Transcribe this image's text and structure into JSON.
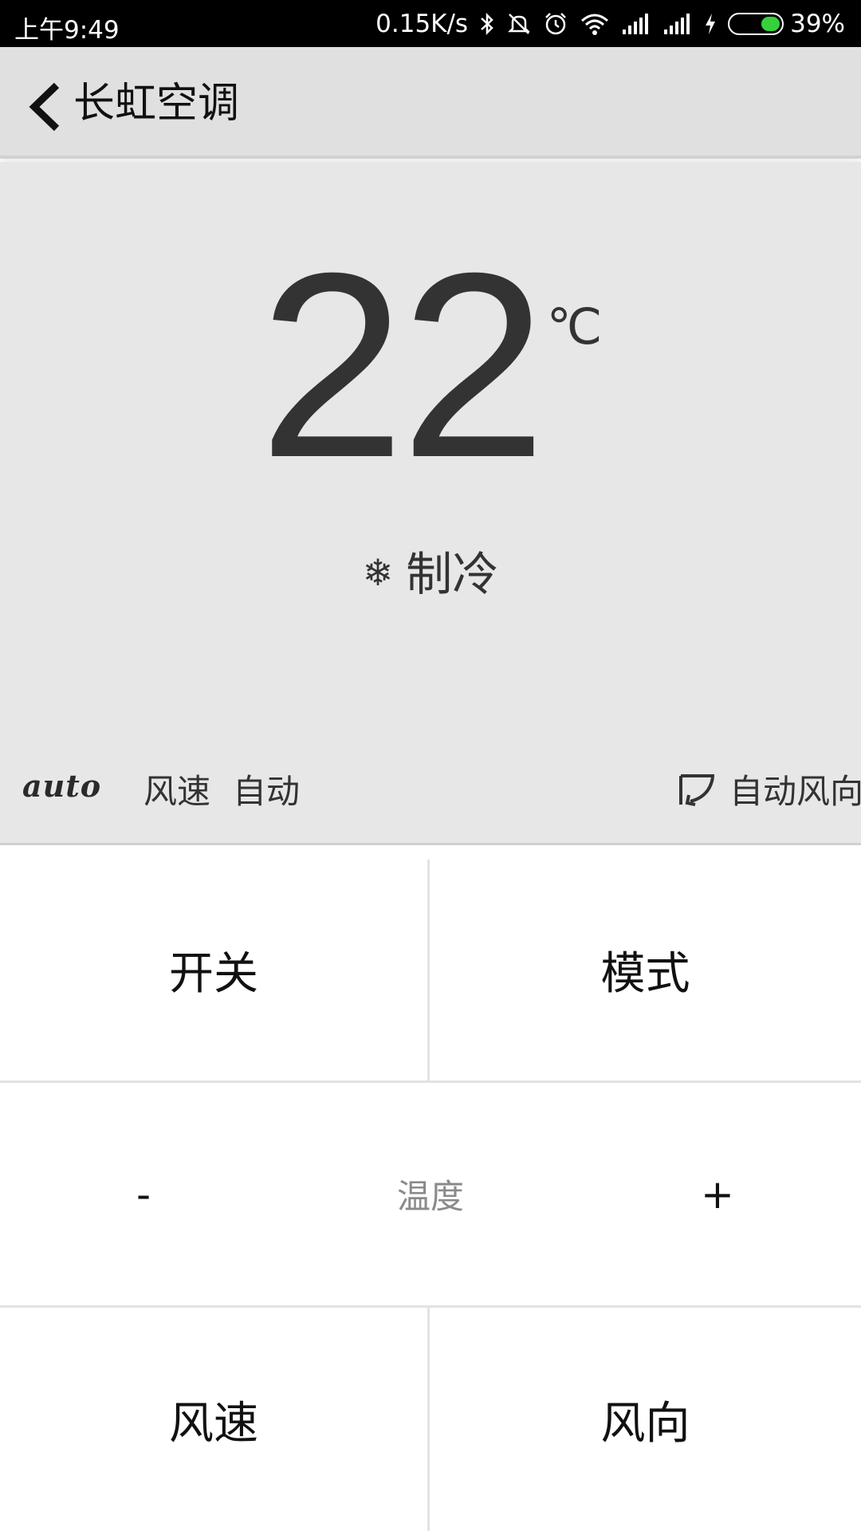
{
  "status_bar": {
    "time": "上午9:49",
    "net_speed": "0.15K/s",
    "battery_percent": "39%",
    "battery_level": 0.39,
    "battery_color": "#37d23b",
    "icons": [
      "bluetooth-icon",
      "mute-icon",
      "alarm-icon",
      "wifi-icon",
      "signal-icon",
      "signal-icon",
      "charging-icon",
      "battery-icon"
    ]
  },
  "header": {
    "title": "长虹空调",
    "back_icon": "chevron-left-icon"
  },
  "display": {
    "temperature": "22",
    "unit": "℃",
    "mode_icon": "❄",
    "mode": "制冷",
    "auto_logo": "auto",
    "fan_label": "风速",
    "fan_value": "自动",
    "swing_label": "自动风向"
  },
  "controls": {
    "power": "开关",
    "mode": "模式",
    "temp_minus": "-",
    "temp_label": "温度",
    "temp_plus": "+",
    "fan_speed": "风速",
    "fan_direction": "风向"
  }
}
